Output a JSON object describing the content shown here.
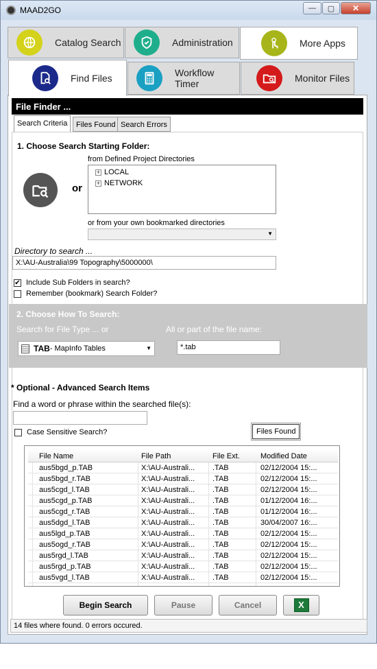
{
  "window": {
    "title": "MAAD2GO",
    "minimize": "—",
    "maximize": "▢",
    "close": "✕"
  },
  "app_tabs": [
    {
      "label": "Catalog Search",
      "color": "#d4d21a"
    },
    {
      "label": "Administration",
      "color": "#1fae8c"
    },
    {
      "label": "More Apps",
      "color": "#a7b51a"
    },
    {
      "label": "Find Files",
      "color": "#1b2a8a"
    },
    {
      "label": "Workflow Timer",
      "color": "#1aa0c2"
    },
    {
      "label": "Monitor Files",
      "color": "#d41a1a"
    }
  ],
  "panel": {
    "header": "File Finder ..."
  },
  "sub_tabs": [
    "Search Criteria",
    "Files Found",
    "Search Errors"
  ],
  "section1": {
    "title": "1. Choose Search Starting Folder:",
    "or_label": "or",
    "tree_label": "from Defined Project Directories",
    "tree_items": [
      "LOCAL",
      "NETWORK"
    ],
    "bookmark_label": "or from your own bookmarked directories",
    "bookmark_value": "",
    "dir_label": "Directory to search ...",
    "dir_value": "X:\\AU-Australia\\99 Topography\\5000000\\",
    "include_sub": "Include Sub Folders in search?",
    "remember": "Remember (bookmark) Search Folder?"
  },
  "section2": {
    "title": "2. Choose How To Search:",
    "type_label": "Search for File Type ... or",
    "type_code": "TAB",
    "type_desc": " - MapInfo Tables",
    "name_label": "All or part of the file name:",
    "name_value": "*.tab"
  },
  "optional": {
    "title": "* Optional - Advanced Search Items",
    "phrase_label": "Find a word or phrase within the searched file(s):",
    "phrase_value": "",
    "case_label": "Case Sensitive Search?",
    "files_found_label": "Files Found"
  },
  "grid": {
    "columns": [
      "File Name",
      "File Path",
      "File Ext.",
      "Modified Date"
    ],
    "rows": [
      [
        "aus5bgd_p.TAB",
        "X:\\AU-Australi...",
        ".TAB",
        "02/12/2004 15:..."
      ],
      [
        "aus5bgd_r.TAB",
        "X:\\AU-Australi...",
        ".TAB",
        "02/12/2004 15:..."
      ],
      [
        "aus5cgd_l.TAB",
        "X:\\AU-Australi...",
        ".TAB",
        "02/12/2004 15:..."
      ],
      [
        "aus5cgd_p.TAB",
        "X:\\AU-Australi...",
        ".TAB",
        "01/12/2004 16:..."
      ],
      [
        "aus5cgd_r.TAB",
        "X:\\AU-Australi...",
        ".TAB",
        "01/12/2004 16:..."
      ],
      [
        "aus5dgd_l.TAB",
        "X:\\AU-Australi...",
        ".TAB",
        "30/04/2007 16:..."
      ],
      [
        "aus5lgd_p.TAB",
        "X:\\AU-Australi...",
        ".TAB",
        "02/12/2004 15:..."
      ],
      [
        "aus5ogd_r.TAB",
        "X:\\AU-Australi...",
        ".TAB",
        "02/12/2004 15:..."
      ],
      [
        "aus5rgd_l.TAB",
        "X:\\AU-Australi...",
        ".TAB",
        "02/12/2004 15:..."
      ],
      [
        "aus5rgd_p.TAB",
        "X:\\AU-Australi...",
        ".TAB",
        "02/12/2004 15:..."
      ],
      [
        "aus5vgd_l.TAB",
        "X:\\AU-Australi...",
        ".TAB",
        "02/12/2004 15:..."
      ]
    ]
  },
  "buttons": {
    "begin": "Begin Search",
    "pause": "Pause",
    "cancel": "Cancel"
  },
  "status": "14 files where found. 0 errors occured."
}
